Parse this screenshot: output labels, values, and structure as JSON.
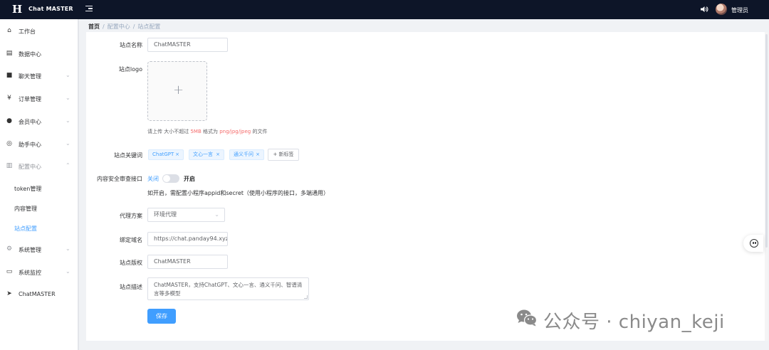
{
  "header": {
    "brand": "Chat MASTER",
    "logo_letter": "H",
    "user_name": "管理员"
  },
  "sidebar": {
    "items": [
      {
        "label": "工作台",
        "icon": "dashboard-icon"
      },
      {
        "label": "数据中心",
        "icon": "data-icon"
      },
      {
        "label": "聊天管理",
        "icon": "chat-icon"
      },
      {
        "label": "订单管理",
        "icon": "yen-icon"
      },
      {
        "label": "会员中心",
        "icon": "member-icon"
      },
      {
        "label": "助手中心",
        "icon": "assistant-icon"
      },
      {
        "label": "配置中心",
        "icon": "config-icon"
      },
      {
        "label": "系统管理",
        "icon": "gear-icon"
      },
      {
        "label": "系统监控",
        "icon": "monitor-icon"
      },
      {
        "label": "ChatMASTER",
        "icon": "send-icon"
      }
    ],
    "sub_items": [
      {
        "label": "token管理"
      },
      {
        "label": "内容管理"
      },
      {
        "label": "站点配置"
      }
    ]
  },
  "breadcrumb": [
    "首页",
    "/",
    "配置中心",
    "/",
    "站点配置"
  ],
  "form": {
    "site_name": {
      "label": "站点名称",
      "value": "ChatMASTER"
    },
    "site_logo": {
      "label": "站点logo",
      "plus": "+"
    },
    "upload_tip": {
      "prefix": "请上传 大小不超过 ",
      "size": "5MB",
      "middle": " 格式为 ",
      "formats": "png/jpg/jpeg",
      "suffix": " 的文件"
    },
    "keywords": {
      "label": "站点关键词",
      "tags": [
        "ChatGPT",
        "文心一言",
        "通义千问"
      ],
      "close": "×",
      "new_tag": "+ 新标签"
    },
    "content_audit": {
      "label": "内容安全审查接口",
      "off": "关闭",
      "on": "开启",
      "note": "如开启，需配置小程序appid和secret（使用小程序的接口，多端通用）",
      "enabled": false
    },
    "proxy": {
      "label": "代理方案",
      "value": "环境代理"
    },
    "domain": {
      "label": "绑定域名",
      "value": "https://chat.panday94.xyz"
    },
    "copyright": {
      "label": "站点版权",
      "value": "ChatMASTER"
    },
    "description": {
      "label": "站点描述",
      "value": "ChatMASTER，支持ChatGPT、文心一言、通义千问、智谱清言等多模型"
    },
    "save_label": "保存"
  },
  "watermark": {
    "text": "公众号 · chiyan_keji"
  },
  "colors": {
    "primary": "#409eff",
    "topbar": "#0d1528",
    "danger": "#f56c6c"
  }
}
